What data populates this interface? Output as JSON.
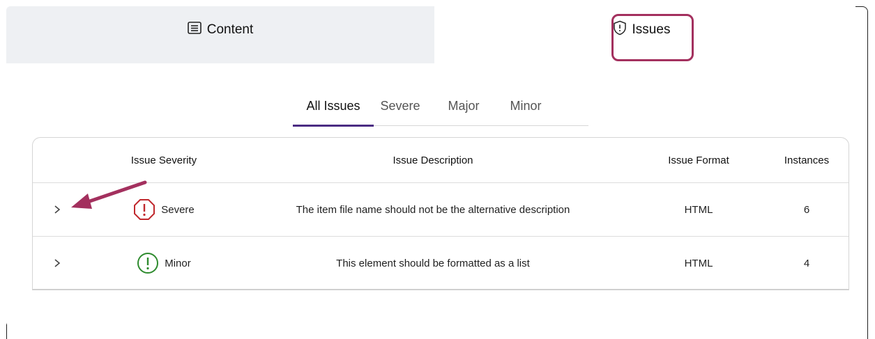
{
  "tabs": {
    "content_label": "Content",
    "issues_label": "Issues"
  },
  "subtabs": [
    "All Issues",
    "Severe",
    "Major",
    "Minor"
  ],
  "table": {
    "headers": {
      "severity": "Issue Severity",
      "description": "Issue Description",
      "format": "Issue Format",
      "instances": "Instances"
    },
    "rows": [
      {
        "severity": "Severe",
        "description": "The item file name should not be the alternative description",
        "format": "HTML",
        "instances": "6"
      },
      {
        "severity": "Minor",
        "description": "This element should be formatted as a list",
        "format": "HTML",
        "instances": "4"
      }
    ]
  },
  "colors": {
    "highlight": "#a3305e",
    "active_underline": "#4b2c83",
    "severe": "#c0282d",
    "minor": "#2e8b2e",
    "arrow": "#a3305e"
  },
  "icons": {
    "content_tab": "list-icon",
    "issues_tab": "shield-alert-icon",
    "severe": "octagon-alert-icon",
    "minor": "circle-alert-icon",
    "expand": "chevron-right-icon"
  }
}
